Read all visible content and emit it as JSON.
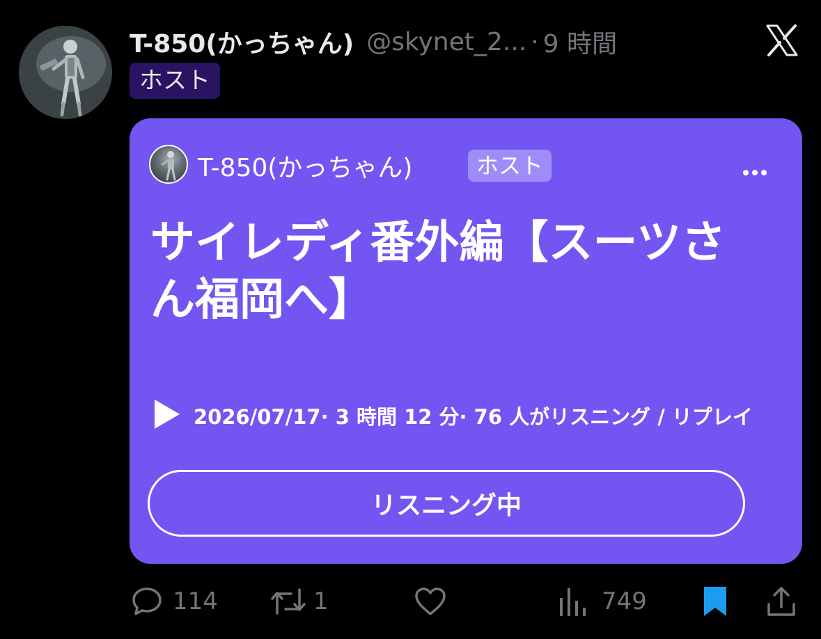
{
  "tweet": {
    "display_name": "T-850(かっちゃん)",
    "handle": "@skynet_2...",
    "separator": "·",
    "time": "9 時間",
    "role_badge": "ホスト"
  },
  "space": {
    "host_name": "T-850(かっちゃん)",
    "host_badge": "ホスト",
    "title": "サイレディ番外編【スーツさん福岡へ】",
    "meta": "2026/07/17· 3 時間 12 分· 76 人がリスニング / リプレイ",
    "button_label": "リスニング中"
  },
  "actions": {
    "replies": "114",
    "reposts": "1",
    "views": "749"
  },
  "icons": {
    "logo": "x-logo-icon",
    "more": "more-horizontal-icon",
    "play": "play-icon",
    "reply": "reply-bubble-icon",
    "repost": "repost-icon",
    "like": "heart-icon",
    "views": "views-bar-chart-icon",
    "bookmark": "bookmark-filled-icon",
    "share": "share-icon"
  },
  "colors": {
    "background": "#000000",
    "card": "#7356f1",
    "muted": "#71767b",
    "bookmark": "#1d9bf0",
    "badge_bg": "#2a1363"
  }
}
